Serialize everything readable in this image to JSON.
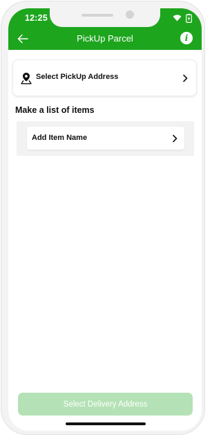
{
  "status_bar": {
    "time": "12:25",
    "icons": [
      "wifi-icon",
      "battery-charging-icon"
    ]
  },
  "app_bar": {
    "title": "PickUp Parcel",
    "back_icon": "back-arrow-icon",
    "info_icon": "info-icon",
    "info_glyph": "i"
  },
  "pickup": {
    "label": "Select PickUp Address",
    "icon": "location-pin-icon"
  },
  "items": {
    "section_title": "Make a list of items",
    "add_item_label": "Add Item Name"
  },
  "footer": {
    "delivery_button_label": "Select Delivery Address"
  },
  "colors": {
    "brand_green": "#1ea51e",
    "disabled_button": "#b4e2b6"
  }
}
